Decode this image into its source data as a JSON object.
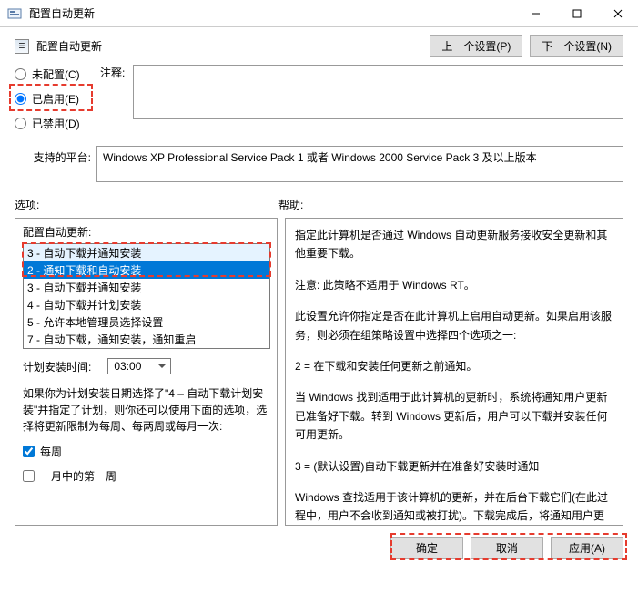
{
  "window": {
    "title": "配置自动更新",
    "header_title": "配置自动更新",
    "prev_btn": "上一个设置(P)",
    "next_btn": "下一个设置(N)"
  },
  "radios": {
    "not_configured": "未配置(C)",
    "enabled": "已启用(E)",
    "disabled": "已禁用(D)"
  },
  "labels": {
    "comment": "注释:",
    "platform": "支持的平台:",
    "options": "选项:",
    "help": "帮助:"
  },
  "platform_text": "Windows XP Professional Service Pack 1 或者 Windows 2000 Service Pack 3 及以上版本",
  "left": {
    "combo_label": "配置自动更新:",
    "options": [
      "3 - 自动下载并通知安装",
      "2 - 通知下载和自动安装",
      "3 - 自动下载并通知安装",
      "4 - 自动下载并计划安装",
      "5 - 允许本地管理员选择设置",
      "7 - 自动下载，通知安装，通知重启"
    ],
    "selected_index": 1,
    "hover_index": 0,
    "sched_label": "计划安装时间:",
    "sched_time": "03:00",
    "info": "如果你为计划安装日期选择了\"4 – 自动下载计划安装\"并指定了计划，则你还可以使用下面的选项，选择将更新限制为每周、每两周或每月一次:",
    "chk_weekly": "每周",
    "chk_first_week": "一月中的第一周"
  },
  "help_paras": [
    "指定此计算机是否通过 Windows 自动更新服务接收安全更新和其他重要下载。",
    "注意: 此策略不适用于 Windows RT。",
    "此设置允许你指定是否在此计算机上启用自动更新。如果启用该服务，则必须在组策略设置中选择四个选项之一:",
    "2 = 在下载和安装任何更新之前通知。",
    "  当 Windows 找到适用于此计算机的更新时，系统将通知用户更新已准备好下载。转到 Windows 更新后，用户可以下载并安装任何可用更新。",
    "3 = (默认设置)自动下载更新并在准备好安装时通知",
    "  Windows 查找适用于该计算机的更新，并在后台下载它们(在此过程中，用户不会收到通知或被打扰)。下载完成后，将通知用户更新已准备好进行安装。在转到 Windows 更新后，用户可以安装它们。"
  ],
  "footer": {
    "ok": "确定",
    "cancel": "取消",
    "apply": "应用(A)"
  }
}
